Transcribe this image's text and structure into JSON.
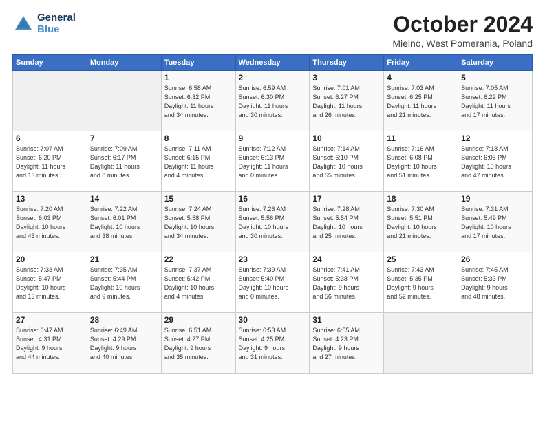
{
  "logo": {
    "line1": "General",
    "line2": "Blue"
  },
  "title": "October 2024",
  "subtitle": "Mielno, West Pomerania, Poland",
  "headers": [
    "Sunday",
    "Monday",
    "Tuesday",
    "Wednesday",
    "Thursday",
    "Friday",
    "Saturday"
  ],
  "weeks": [
    [
      {
        "day": "",
        "info": ""
      },
      {
        "day": "",
        "info": ""
      },
      {
        "day": "1",
        "info": "Sunrise: 6:58 AM\nSunset: 6:32 PM\nDaylight: 11 hours\nand 34 minutes."
      },
      {
        "day": "2",
        "info": "Sunrise: 6:59 AM\nSunset: 6:30 PM\nDaylight: 11 hours\nand 30 minutes."
      },
      {
        "day": "3",
        "info": "Sunrise: 7:01 AM\nSunset: 6:27 PM\nDaylight: 11 hours\nand 26 minutes."
      },
      {
        "day": "4",
        "info": "Sunrise: 7:03 AM\nSunset: 6:25 PM\nDaylight: 11 hours\nand 21 minutes."
      },
      {
        "day": "5",
        "info": "Sunrise: 7:05 AM\nSunset: 6:22 PM\nDaylight: 11 hours\nand 17 minutes."
      }
    ],
    [
      {
        "day": "6",
        "info": "Sunrise: 7:07 AM\nSunset: 6:20 PM\nDaylight: 11 hours\nand 13 minutes."
      },
      {
        "day": "7",
        "info": "Sunrise: 7:09 AM\nSunset: 6:17 PM\nDaylight: 11 hours\nand 8 minutes."
      },
      {
        "day": "8",
        "info": "Sunrise: 7:11 AM\nSunset: 6:15 PM\nDaylight: 11 hours\nand 4 minutes."
      },
      {
        "day": "9",
        "info": "Sunrise: 7:12 AM\nSunset: 6:13 PM\nDaylight: 11 hours\nand 0 minutes."
      },
      {
        "day": "10",
        "info": "Sunrise: 7:14 AM\nSunset: 6:10 PM\nDaylight: 10 hours\nand 55 minutes."
      },
      {
        "day": "11",
        "info": "Sunrise: 7:16 AM\nSunset: 6:08 PM\nDaylight: 10 hours\nand 51 minutes."
      },
      {
        "day": "12",
        "info": "Sunrise: 7:18 AM\nSunset: 6:05 PM\nDaylight: 10 hours\nand 47 minutes."
      }
    ],
    [
      {
        "day": "13",
        "info": "Sunrise: 7:20 AM\nSunset: 6:03 PM\nDaylight: 10 hours\nand 43 minutes."
      },
      {
        "day": "14",
        "info": "Sunrise: 7:22 AM\nSunset: 6:01 PM\nDaylight: 10 hours\nand 38 minutes."
      },
      {
        "day": "15",
        "info": "Sunrise: 7:24 AM\nSunset: 5:58 PM\nDaylight: 10 hours\nand 34 minutes."
      },
      {
        "day": "16",
        "info": "Sunrise: 7:26 AM\nSunset: 5:56 PM\nDaylight: 10 hours\nand 30 minutes."
      },
      {
        "day": "17",
        "info": "Sunrise: 7:28 AM\nSunset: 5:54 PM\nDaylight: 10 hours\nand 25 minutes."
      },
      {
        "day": "18",
        "info": "Sunrise: 7:30 AM\nSunset: 5:51 PM\nDaylight: 10 hours\nand 21 minutes."
      },
      {
        "day": "19",
        "info": "Sunrise: 7:31 AM\nSunset: 5:49 PM\nDaylight: 10 hours\nand 17 minutes."
      }
    ],
    [
      {
        "day": "20",
        "info": "Sunrise: 7:33 AM\nSunset: 5:47 PM\nDaylight: 10 hours\nand 13 minutes."
      },
      {
        "day": "21",
        "info": "Sunrise: 7:35 AM\nSunset: 5:44 PM\nDaylight: 10 hours\nand 9 minutes."
      },
      {
        "day": "22",
        "info": "Sunrise: 7:37 AM\nSunset: 5:42 PM\nDaylight: 10 hours\nand 4 minutes."
      },
      {
        "day": "23",
        "info": "Sunrise: 7:39 AM\nSunset: 5:40 PM\nDaylight: 10 hours\nand 0 minutes."
      },
      {
        "day": "24",
        "info": "Sunrise: 7:41 AM\nSunset: 5:38 PM\nDaylight: 9 hours\nand 56 minutes."
      },
      {
        "day": "25",
        "info": "Sunrise: 7:43 AM\nSunset: 5:35 PM\nDaylight: 9 hours\nand 52 minutes."
      },
      {
        "day": "26",
        "info": "Sunrise: 7:45 AM\nSunset: 5:33 PM\nDaylight: 9 hours\nand 48 minutes."
      }
    ],
    [
      {
        "day": "27",
        "info": "Sunrise: 6:47 AM\nSunset: 4:31 PM\nDaylight: 9 hours\nand 44 minutes."
      },
      {
        "day": "28",
        "info": "Sunrise: 6:49 AM\nSunset: 4:29 PM\nDaylight: 9 hours\nand 40 minutes."
      },
      {
        "day": "29",
        "info": "Sunrise: 6:51 AM\nSunset: 4:27 PM\nDaylight: 9 hours\nand 35 minutes."
      },
      {
        "day": "30",
        "info": "Sunrise: 6:53 AM\nSunset: 4:25 PM\nDaylight: 9 hours\nand 31 minutes."
      },
      {
        "day": "31",
        "info": "Sunrise: 6:55 AM\nSunset: 4:23 PM\nDaylight: 9 hours\nand 27 minutes."
      },
      {
        "day": "",
        "info": ""
      },
      {
        "day": "",
        "info": ""
      }
    ]
  ]
}
